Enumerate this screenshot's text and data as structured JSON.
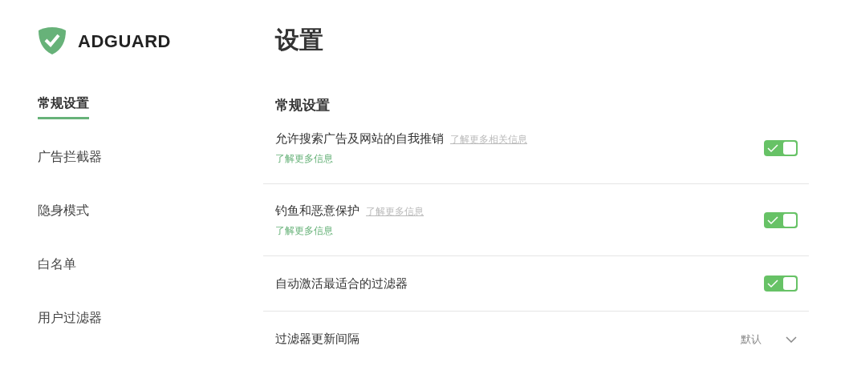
{
  "logo": {
    "text": "ADGUARD"
  },
  "sidebar": {
    "items": [
      {
        "label": "常规设置",
        "selected": true
      },
      {
        "label": "广告拦截器",
        "selected": false
      },
      {
        "label": "隐身模式",
        "selected": false
      },
      {
        "label": "白名单",
        "selected": false
      },
      {
        "label": "用户过滤器",
        "selected": false
      }
    ]
  },
  "page_title": "设置",
  "section_title": "常规设置",
  "settings": [
    {
      "kind": "toggle",
      "label": "允许搜索广告及网站的自我推销",
      "inline_link": "了解更多相关信息",
      "sub_link": "了解更多信息",
      "on": true
    },
    {
      "kind": "toggle",
      "label": "钓鱼和恶意保护",
      "inline_link": "了解更多信息",
      "sub_link": "了解更多信息",
      "on": true
    },
    {
      "kind": "toggle",
      "label": "自动激活最适合的过滤器",
      "on": true
    },
    {
      "kind": "select",
      "label": "过滤器更新间隔",
      "value": "默认"
    }
  ]
}
